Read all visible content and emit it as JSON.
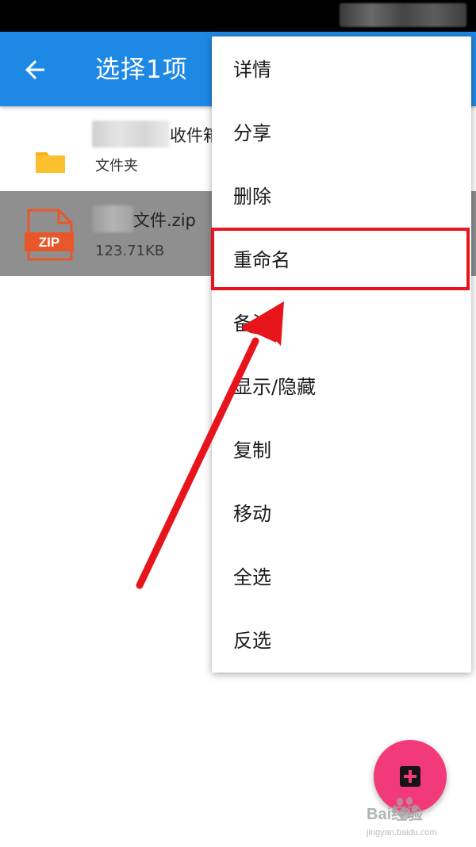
{
  "app_bar": {
    "title": "选择1项",
    "back_icon": "back-arrow-icon",
    "color": "#1e88e5"
  },
  "files": [
    {
      "name": "收件箱",
      "subtitle": "文件夹",
      "icon": "folder-icon",
      "selected": false
    },
    {
      "name": "文件.zip",
      "subtitle": "123.71KB",
      "icon": "zip-file-icon",
      "icon_text": "ZIP",
      "selected": true
    }
  ],
  "menu": {
    "items": [
      {
        "label": "详情"
      },
      {
        "label": "分享"
      },
      {
        "label": "删除"
      },
      {
        "label": "重命名",
        "highlighted": true
      },
      {
        "label": "备注"
      },
      {
        "label": "显示/隐藏"
      },
      {
        "label": "复制"
      },
      {
        "label": "移动"
      },
      {
        "label": "全选"
      },
      {
        "label": "反选"
      }
    ]
  },
  "annotation": {
    "highlight_color": "#e8141c",
    "arrow_color": "#e8141c"
  },
  "fab": {
    "icon": "add-icon",
    "color": "#f23a7a"
  },
  "watermark": {
    "main": "Bai经验",
    "url": "jingyan.baidu.com"
  }
}
